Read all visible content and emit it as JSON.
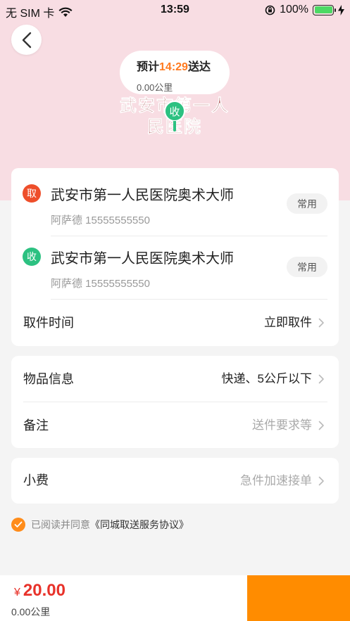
{
  "status_bar": {
    "carrier": "无 SIM 卡",
    "time": "13:59",
    "battery": "100%"
  },
  "map": {
    "eta_prefix": "预计",
    "eta_time": "14:29",
    "eta_suffix": "送达",
    "distance": "0.00公里",
    "place_label": "武安市第一人民医院",
    "pin_label": "收"
  },
  "pickup": {
    "badge": "取",
    "name": "武安市第一人民医院奥术大师",
    "contact": "阿萨德 15555555550",
    "common_label": "常用"
  },
  "receive": {
    "badge": "收",
    "name": "武安市第一人民医院奥术大师",
    "contact": "阿萨德 15555555550",
    "common_label": "常用"
  },
  "pickup_time": {
    "label": "取件时间",
    "value": "立即取件"
  },
  "item_info": {
    "label": "物品信息",
    "value": "快递、5公斤以下"
  },
  "remark": {
    "label": "备注",
    "placeholder": "送件要求等"
  },
  "tip": {
    "label": "小费",
    "placeholder": "急件加速接单"
  },
  "agreement": {
    "text": "已阅读并同意",
    "link": "《同城取送服务协议》"
  },
  "bottom": {
    "currency": "¥",
    "price": "20.00",
    "distance": "0.00公里"
  },
  "colors": {
    "accent": "#ff8c00",
    "price": "#e8322a",
    "pickup_badge": "#ee4e2a",
    "receive_badge": "#2cc181",
    "map_bg": "#f8dde3"
  }
}
